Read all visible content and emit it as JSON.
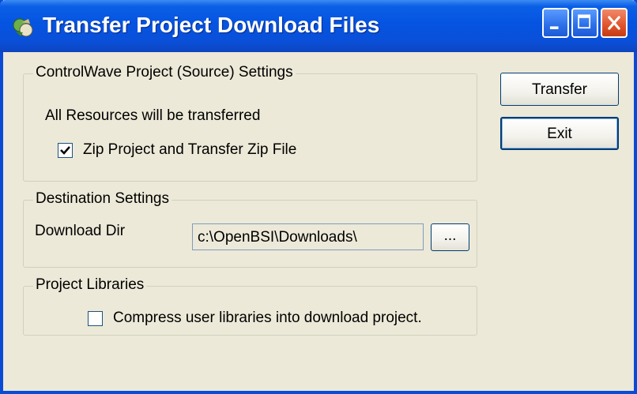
{
  "window": {
    "title": "Transfer Project Download Files",
    "icon": "transfer-app-icon"
  },
  "titlebar_buttons": [
    "minimize",
    "maximize",
    "close"
  ],
  "source_group": {
    "label": "ControlWave Project (Source) Settings",
    "info_text": "All Resources will be transferred",
    "zip_checkbox": {
      "label": "Zip Project and Transfer Zip File",
      "checked": true
    }
  },
  "destination_group": {
    "label": "Destination Settings",
    "download_dir_label": "Download Dir",
    "download_dir_value": "c:\\OpenBSI\\Downloads\\",
    "browse_label": "..."
  },
  "libraries_group": {
    "label": "Project Libraries",
    "compress_checkbox": {
      "label": "Compress user libraries into download project.",
      "checked": false
    }
  },
  "buttons": {
    "transfer": "Transfer",
    "exit": "Exit"
  },
  "colors": {
    "titlebar": "#0554E1",
    "dialog_bg": "#ECE9D8",
    "close_button": "#E0542A"
  }
}
